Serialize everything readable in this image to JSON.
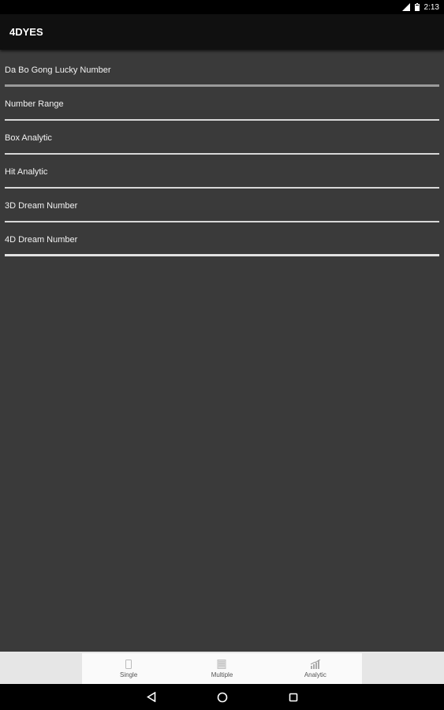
{
  "status_bar": {
    "time": "2:13",
    "icons": [
      "signal-icon",
      "battery-icon"
    ]
  },
  "app_bar": {
    "title": "4DYES"
  },
  "menu": {
    "items": [
      {
        "label": "Da Bo Gong Lucky Number"
      },
      {
        "label": "Number Range"
      },
      {
        "label": "Box Analytic"
      },
      {
        "label": "Hit Analytic"
      },
      {
        "label": "3D Dream Number"
      },
      {
        "label": "4D Dream Number"
      }
    ]
  },
  "bottom_nav": {
    "tabs": [
      {
        "label": "Single",
        "icon": "single-icon"
      },
      {
        "label": "Multiple",
        "icon": "multiple-icon"
      },
      {
        "label": "Analytic",
        "icon": "analytic-icon"
      }
    ]
  },
  "system_nav": {
    "icons": [
      "back-icon",
      "home-icon",
      "recents-icon"
    ]
  }
}
